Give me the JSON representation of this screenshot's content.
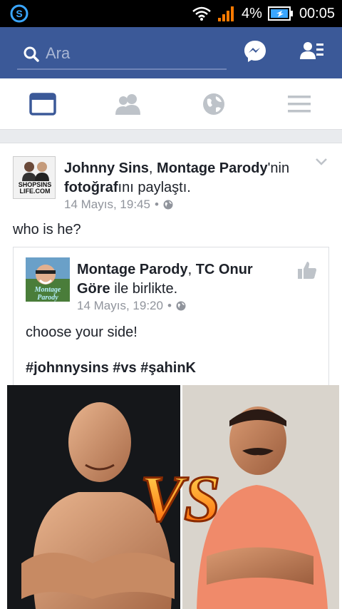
{
  "status_bar": {
    "battery": "4%",
    "time": "00:05"
  },
  "search": {
    "placeholder": "Ara"
  },
  "tabs": [
    {
      "icon": "news-feed-icon",
      "active": true
    },
    {
      "icon": "friends-icon",
      "active": false
    },
    {
      "icon": "globe-icon",
      "active": false
    },
    {
      "icon": "menu-icon",
      "active": false
    }
  ],
  "post": {
    "author": "Johnny Sins",
    "comma": ", ",
    "page": "Montage Parody",
    "possessive": "'nin ",
    "object": "fotoğraf",
    "action_suffix": "ını paylaştı.",
    "timestamp": "14 Mayıs, 19:45",
    "separator": " • ",
    "text": "who is he?",
    "avatar_text": {
      "line1": "SHOPSINS",
      "line2": "LIFE.COM"
    }
  },
  "shared": {
    "author": "Montage Parody",
    "comma": ", ",
    "with_person": "TC Onur Göre",
    "with_suffix": " ile birlikte.",
    "timestamp": "14 Mayıs, 19:20",
    "separator": " • ",
    "text": "choose your side!",
    "hashtags": "#johnnysins #vs #şahinK",
    "avatar_text": {
      "line1": "Montage",
      "line2": "Parody"
    }
  },
  "photo": {
    "vs_text": "VS",
    "left_bg": "#15171a",
    "right_bg": "#d9d4cc",
    "vs_color": "#ff8a1a"
  },
  "colors": {
    "brand": "#3b5998",
    "text": "#1d2129",
    "meta": "#90949c"
  }
}
